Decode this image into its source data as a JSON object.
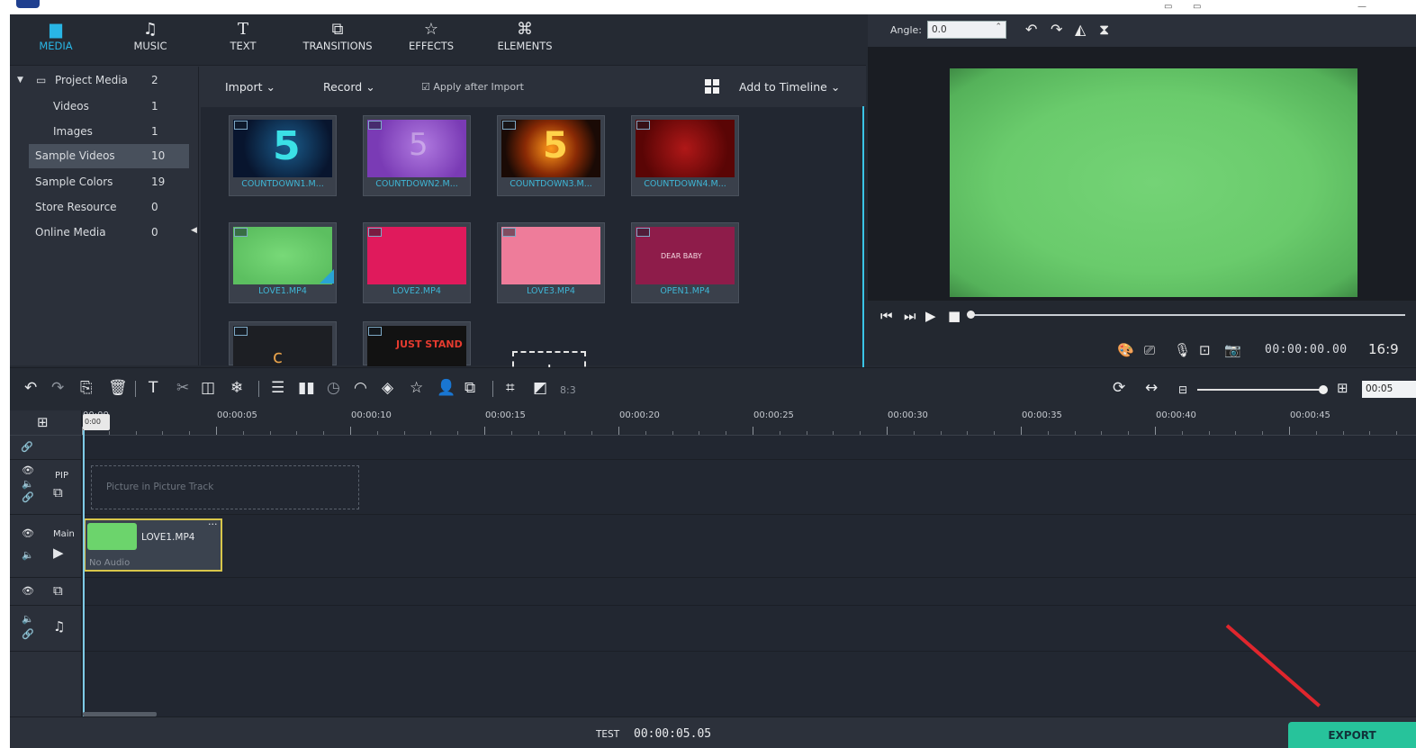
{
  "tabs": [
    {
      "label": "MEDIA",
      "icon": "folder-icon"
    },
    {
      "label": "MUSIC",
      "icon": "music-note-icon"
    },
    {
      "label": "TEXT",
      "icon": "text-icon"
    },
    {
      "label": "TRANSITIONS",
      "icon": "transitions-icon"
    },
    {
      "label": "EFFECTS",
      "icon": "effects-star-icon"
    },
    {
      "label": "ELEMENTS",
      "icon": "elements-icon"
    }
  ],
  "library": [
    {
      "label": "Project Media",
      "count": "2"
    },
    {
      "label": "Videos",
      "count": "1"
    },
    {
      "label": "Images",
      "count": "1"
    },
    {
      "label": "Sample Videos",
      "count": "10"
    },
    {
      "label": "Sample Colors",
      "count": "19"
    },
    {
      "label": "Store Resource",
      "count": "0"
    },
    {
      "label": "Online Media",
      "count": "0"
    }
  ],
  "media_toolbar": {
    "import": "Import",
    "record": "Record",
    "apply_after_import": "Apply after Import",
    "add_to_timeline": "Add to Timeline"
  },
  "media_items": [
    {
      "caption": "COUNTDOWN1.M..."
    },
    {
      "caption": "COUNTDOWN2.M..."
    },
    {
      "caption": "COUNTDOWN3.M..."
    },
    {
      "caption": "COUNTDOWN4.M..."
    },
    {
      "caption": "LOVE1.MP4"
    },
    {
      "caption": "LOVE2.MP4"
    },
    {
      "caption": "LOVE3.MP4"
    },
    {
      "caption": "OPEN1.MP4",
      "thumb_text": "DEAR BABY"
    },
    {
      "caption": ""
    },
    {
      "caption": "",
      "thumb_text": "JUST STAND"
    }
  ],
  "preview": {
    "angle_label": "Angle:",
    "angle_value": "0.0",
    "timecode": "00:00:00.00",
    "aspect": "16:9",
    "progress": 0
  },
  "timeline": {
    "ratio_label": "8:3",
    "zoom_value": "00:05",
    "playhead_time": "0:00",
    "ruler": [
      "00:00",
      "00:00:05",
      "00:00:10",
      "00:00:15",
      "00:00:20",
      "00:00:25",
      "00:00:30",
      "00:00:35",
      "00:00:40",
      "00:00:45"
    ],
    "pip_label": "PIP",
    "pip_placeholder": "Picture in Picture Track",
    "main_label": "Main",
    "clip_name": "LOVE1.MP4",
    "clip_audio": "No Audio"
  },
  "bottom": {
    "project_name": "TEST",
    "duration": "00:00:05.05",
    "export": "EXPORT"
  },
  "colors": {
    "accent": "#29b6e6",
    "export": "#27c39b",
    "clip_border": "#d8c64a",
    "annotation_arrow": "#e0262d",
    "screen_green": "#6acb6c"
  }
}
